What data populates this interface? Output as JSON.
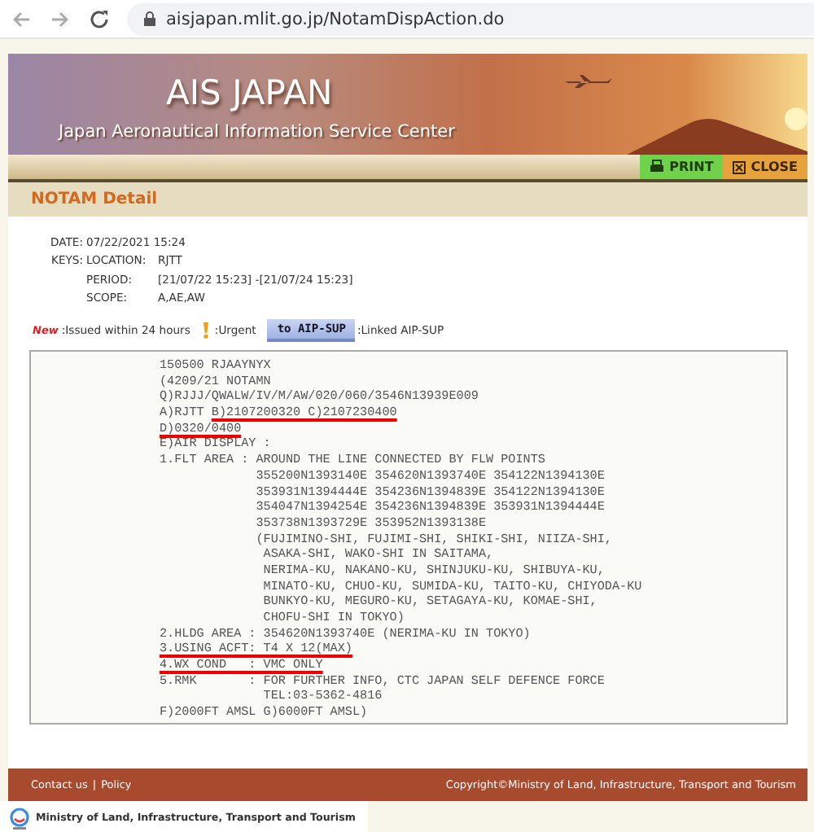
{
  "browser": {
    "url": "aisjapan.mlit.go.jp/NotamDispAction.do"
  },
  "header": {
    "title": "AIS JAPAN",
    "subtitle": "Japan Aeronautical Information Service Center"
  },
  "toolbar": {
    "buttons": [
      {
        "kind": "print",
        "label": "PRINT"
      },
      {
        "kind": "close",
        "label": "CLOSE"
      }
    ]
  },
  "section_title": "NOTAM Detail",
  "info": {
    "date_label": "DATE:",
    "date": "07/22/2021 15:24",
    "keys_label": "KEYS:",
    "keys": [
      {
        "label": "LOCATION:",
        "value": "RJTT"
      },
      {
        "label": "PERIOD:",
        "value": "[21/07/22 15:23] -[21/07/24 15:23]"
      },
      {
        "label": "SCOPE:",
        "value": "A,AE,AW"
      }
    ]
  },
  "legend": [
    {
      "kind": "new",
      "badge": "New",
      "text": ":Issued within 24 hours"
    },
    {
      "kind": "urgent",
      "text": ":Urgent"
    },
    {
      "kind": "aip",
      "button": "to AIP-SUP",
      "text": ":Linked AIP-SUP"
    }
  ],
  "notam": {
    "lines": [
      [
        {
          "text": "150500 RJAAYNYX",
          "underlined": false
        }
      ],
      [
        {
          "text": "(4209/21 NOTAMN",
          "underlined": false
        }
      ],
      [
        {
          "text": "Q)RJJJ/QWALW/IV/M/AW/020/060/3546N13939E009",
          "underlined": false
        }
      ],
      [
        {
          "text": "A)RJTT ",
          "underlined": false
        },
        {
          "text": "B)2107200320 C)2107230400",
          "underlined": true
        }
      ],
      [
        {
          "text": "D)0320/0400",
          "underlined": true
        }
      ],
      [
        {
          "text": "E)AIR DISPLAY :",
          "underlined": false
        }
      ],
      [
        {
          "text": "1.FLT AREA : AROUND THE LINE CONNECTED BY FLW POINTS",
          "underlined": false
        }
      ],
      [
        {
          "text": "             355200N1393140E 354620N1393740E 354122N1394130E",
          "underlined": false
        }
      ],
      [
        {
          "text": "             353931N1394444E 354236N1394839E 354122N1394130E",
          "underlined": false
        }
      ],
      [
        {
          "text": "             354047N1394254E 354236N1394839E 353931N1394444E",
          "underlined": false
        }
      ],
      [
        {
          "text": "             353738N1393729E 353952N1393138E",
          "underlined": false
        }
      ],
      [
        {
          "text": "             (FUJIMINO-SHI, FUJIMI-SHI, SHIKI-SHI, NIIZA-SHI,",
          "underlined": false
        }
      ],
      [
        {
          "text": "              ASAKA-SHI, WAKO-SHI IN SAITAMA,",
          "underlined": false
        }
      ],
      [
        {
          "text": "              NERIMA-KU, NAKANO-KU, SHINJUKU-KU, SHIBUYA-KU,",
          "underlined": false
        }
      ],
      [
        {
          "text": "              MINATO-KU, CHUO-KU, SUMIDA-KU, TAITO-KU, CHIYODA-KU",
          "underlined": false
        }
      ],
      [
        {
          "text": "              BUNKYO-KU, MEGURO-KU, SETAGAYA-KU, KOMAE-SHI,",
          "underlined": false
        }
      ],
      [
        {
          "text": "              CHOFU-SHI IN TOKYO)",
          "underlined": false
        }
      ],
      [
        {
          "text": "2.HLDG AREA : 354620N1393740E (NERIMA-KU IN TOKYO)",
          "underlined": false
        }
      ],
      [
        {
          "text": "3.USING ACFT: T4 X 12(MAX)",
          "underlined": true
        }
      ],
      [
        {
          "text": "4.WX COND   : VMC ONLY",
          "underlined": true
        }
      ],
      [
        {
          "text": "5.RMK       : FOR FURTHER INFO, CTC JAPAN SELF DEFENCE FORCE",
          "underlined": false
        }
      ],
      [
        {
          "text": "              TEL:03-5362-4816",
          "underlined": false
        }
      ],
      [
        {
          "text": "F)2000FT AMSL G)6000FT AMSL)",
          "underlined": false
        }
      ]
    ]
  },
  "footer": {
    "links": [
      "Contact us",
      "Policy"
    ],
    "separator": "|",
    "copyright": "Copyright©Ministry of Land, Infrastructure, Transport and Tourism"
  },
  "ministry": "Ministry of Land, Infrastructure, Transport and Tourism"
}
